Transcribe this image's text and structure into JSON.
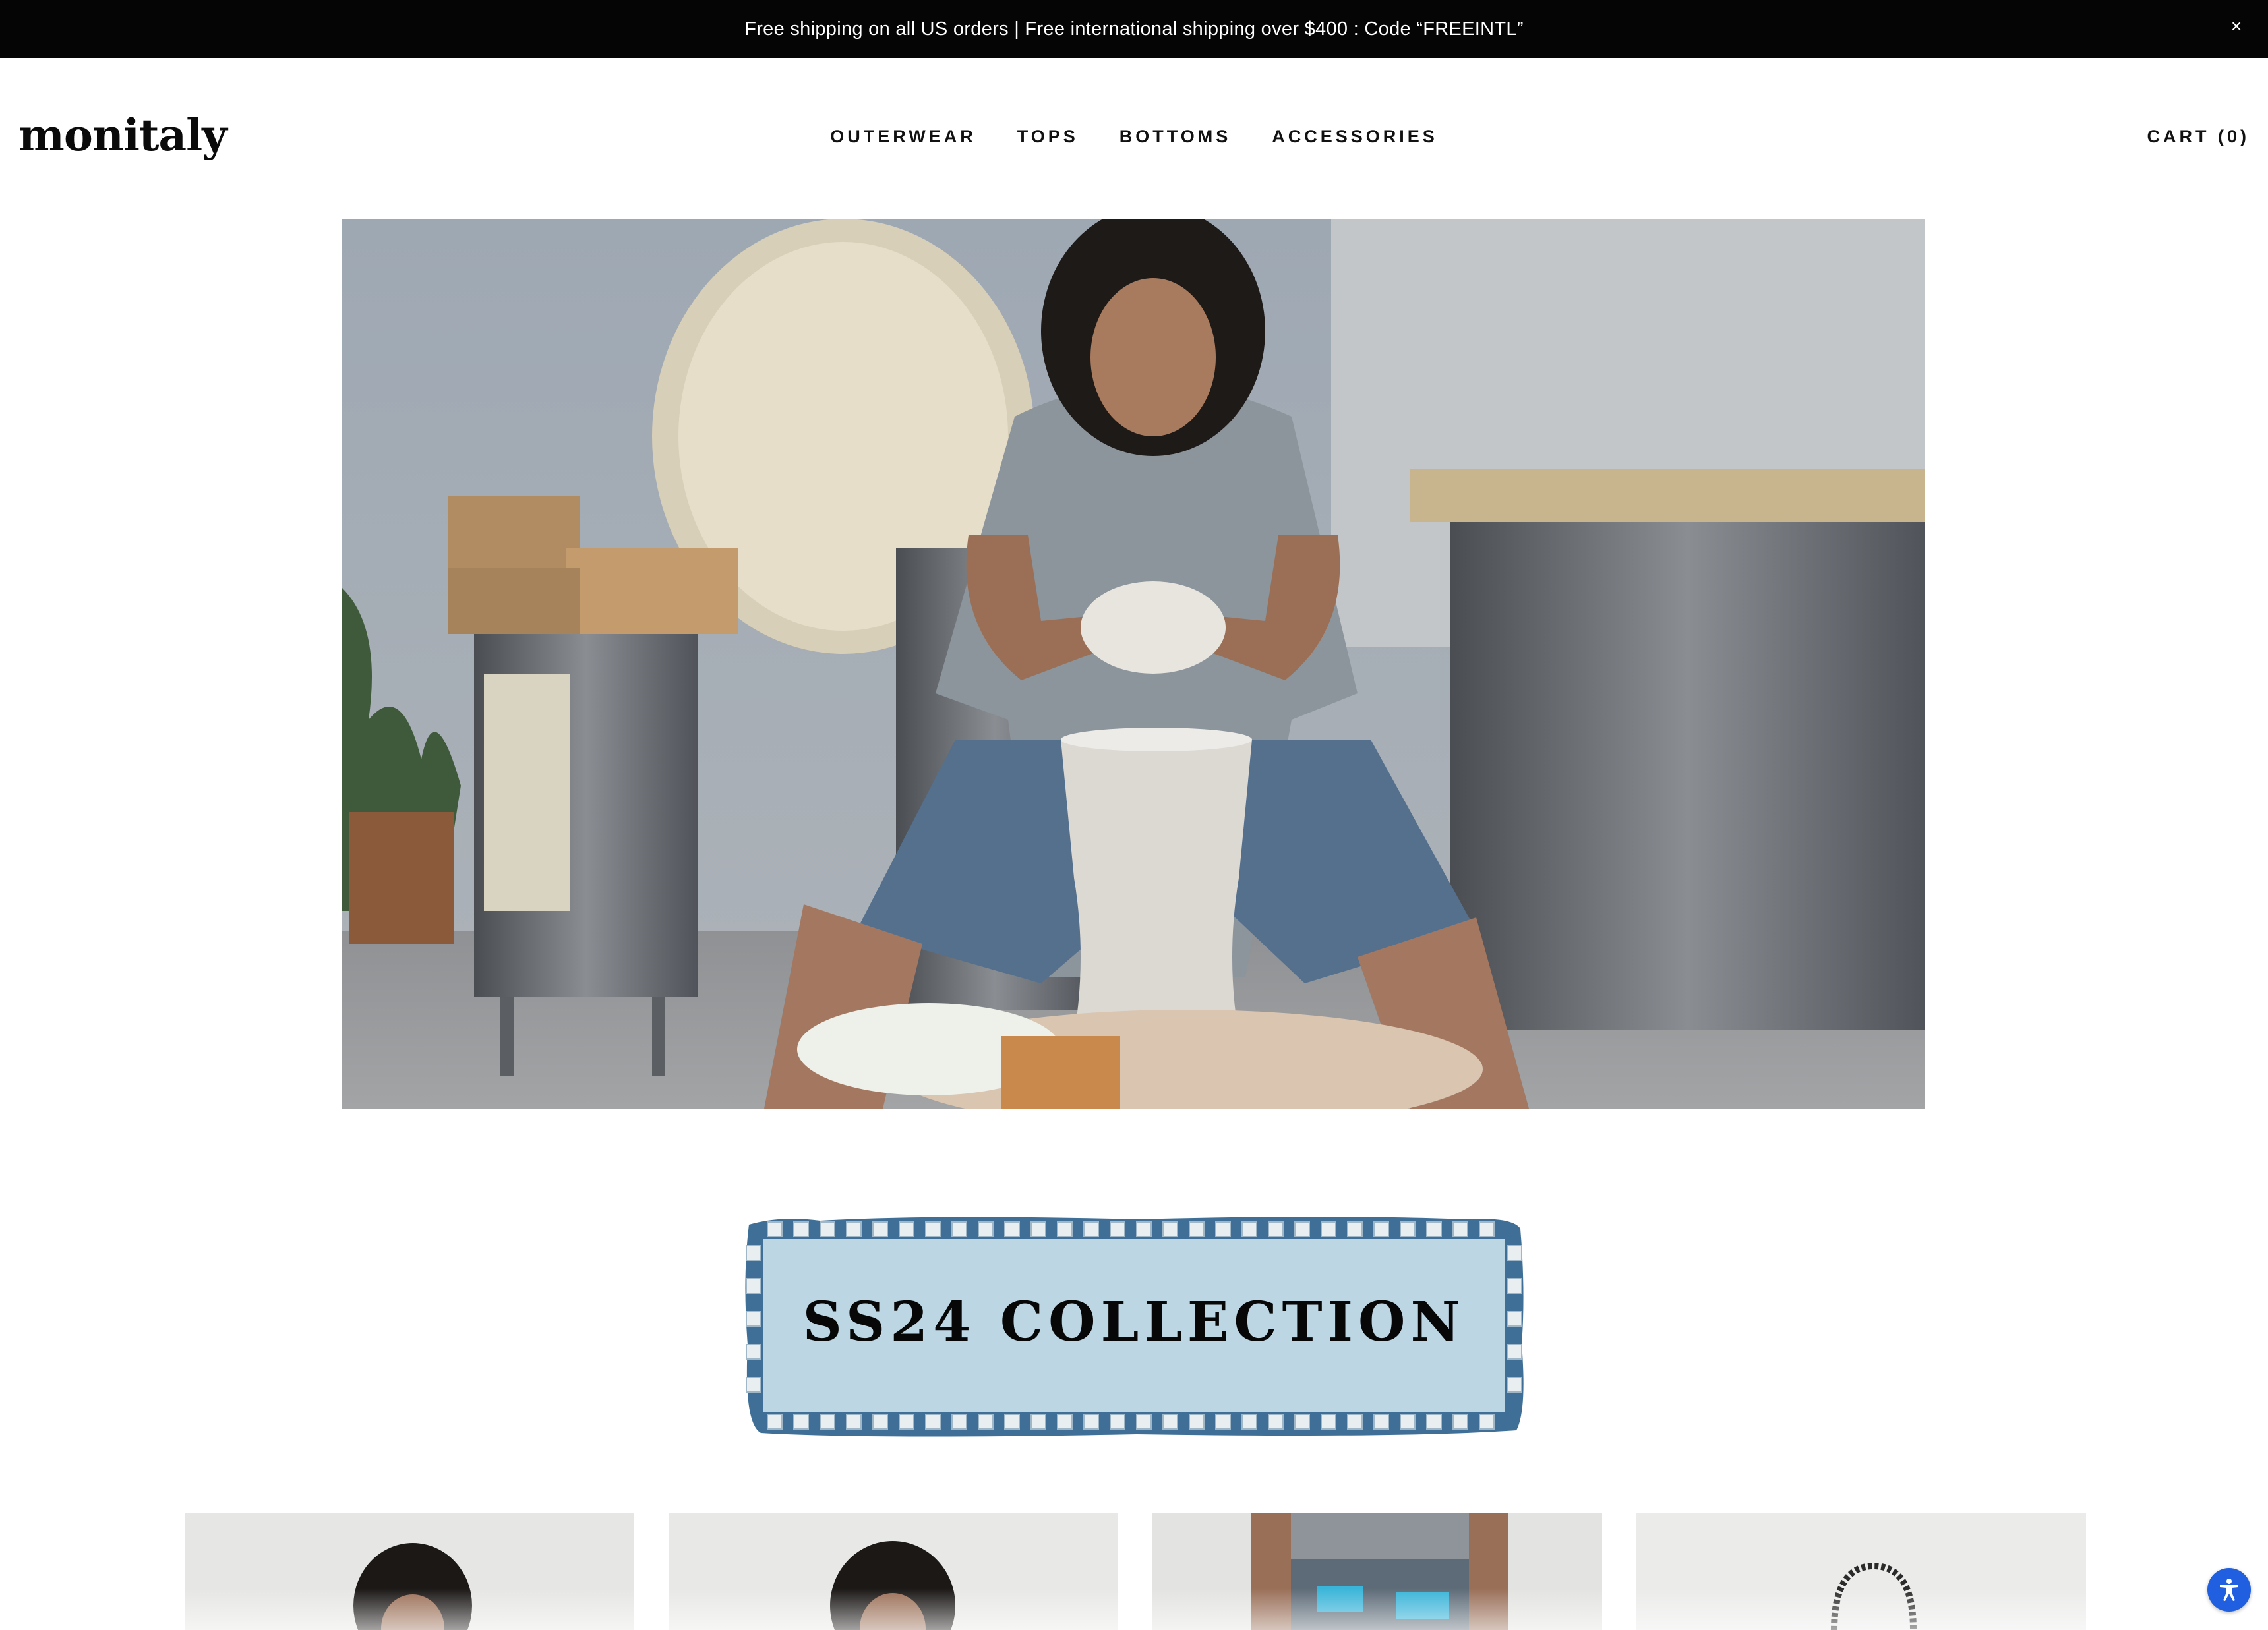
{
  "announcement": {
    "text": "Free shipping on all US orders | Free international shipping over $400 : Code “FREEINTL”",
    "close_icon": "close-icon",
    "close_glyph": "×"
  },
  "header": {
    "logo": "monitaly",
    "nav": [
      "OUTERWEAR",
      "TOPS",
      "BOTTOMS",
      "ACCESSORIES"
    ],
    "cart_label": "CART (0)"
  },
  "hero": {
    "subject": "potter-at-wheel-photo"
  },
  "collection": {
    "title": "SS24 COLLECTION"
  },
  "products": [
    {
      "image": "model-portrait-1"
    },
    {
      "image": "model-portrait-2"
    },
    {
      "image": "shorts-closeup"
    },
    {
      "image": "bag-product"
    }
  ],
  "accessibility": {
    "icon": "accessibility-icon"
  },
  "colors": {
    "announcement_bg": "#050505",
    "banner_fill": "#bcd6e4",
    "banner_border": "#3f6f96",
    "a11y_blue": "#1f5fe0"
  }
}
